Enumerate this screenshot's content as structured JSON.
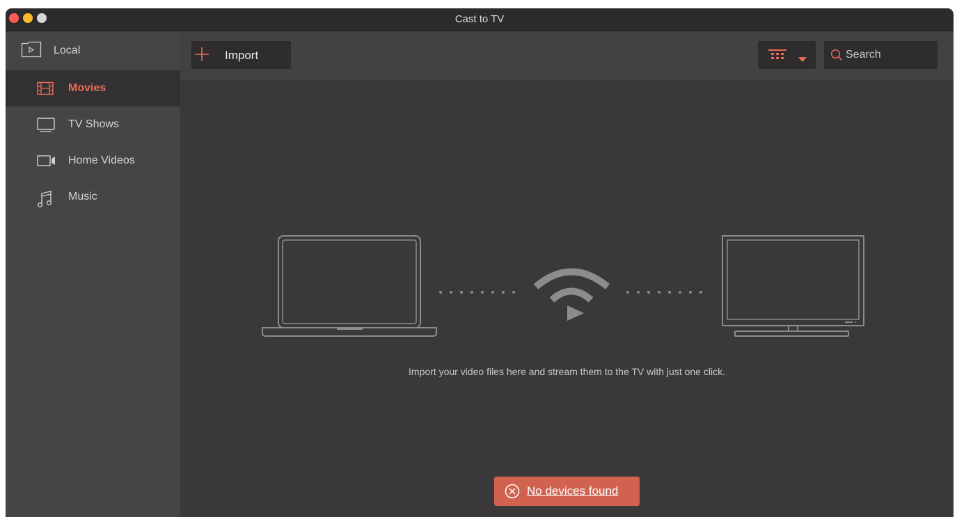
{
  "window": {
    "title": "Cast to TV"
  },
  "sidebar": {
    "local_label": "Local",
    "items": [
      {
        "label": "Movies",
        "icon": "film-icon",
        "active": true
      },
      {
        "label": "TV Shows",
        "icon": "tv-icon",
        "active": false
      },
      {
        "label": "Home Videos",
        "icon": "video-camera-icon",
        "active": false
      },
      {
        "label": "Music",
        "icon": "music-note-icon",
        "active": false
      }
    ]
  },
  "toolbar": {
    "import_label": "Import",
    "view_icon": "grid-view-icon",
    "search_placeholder": "Search"
  },
  "main": {
    "hint": "Import your video files here and stream them to the TV with just one click.",
    "illustration": [
      "laptop-icon",
      "cast-icon",
      "television-icon"
    ]
  },
  "status": {
    "no_devices_label": "No devices found"
  },
  "colors": {
    "accent": "#eb6b56",
    "error_banner": "#d0624f",
    "sidebar_bg": "#464445",
    "main_bg": "#3a3839"
  }
}
